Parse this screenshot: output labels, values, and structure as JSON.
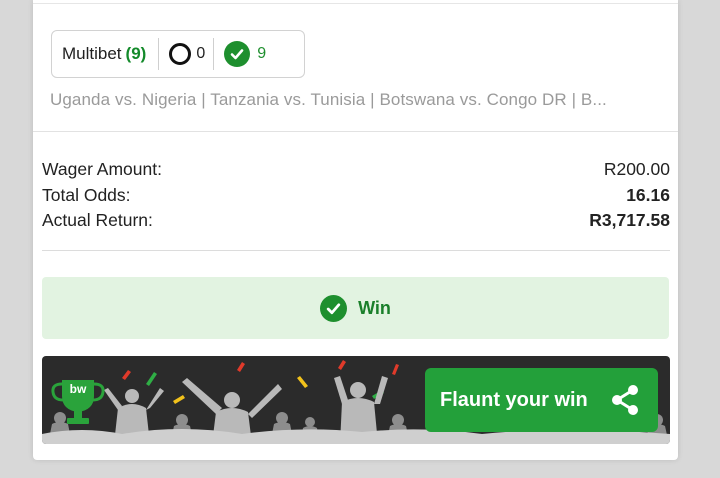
{
  "multibet": {
    "label": "Multibet",
    "count": "(9)",
    "open_count": "0",
    "won_count": "9"
  },
  "matches_text": "Uganda vs. Nigeria | Tanzania vs. Tunisia | Botswana vs. Congo DR | B...",
  "summary": {
    "wager_label": "Wager Amount:",
    "wager_value": "R200.00",
    "odds_label": "Total Odds:",
    "odds_value": "16.16",
    "return_label": "Actual Return:",
    "return_value": "R3,717.58"
  },
  "result": {
    "label": "Win",
    "icon": "check-circle-icon"
  },
  "flaunt": {
    "logo_text": "bw",
    "label": "Flaunt your win",
    "icon": "share-icon"
  },
  "colors": {
    "brand_green": "#1e8f2e",
    "win_bg": "#e2f3e1",
    "button_green": "#23a03a",
    "banner_dark": "#2b2b2b"
  }
}
